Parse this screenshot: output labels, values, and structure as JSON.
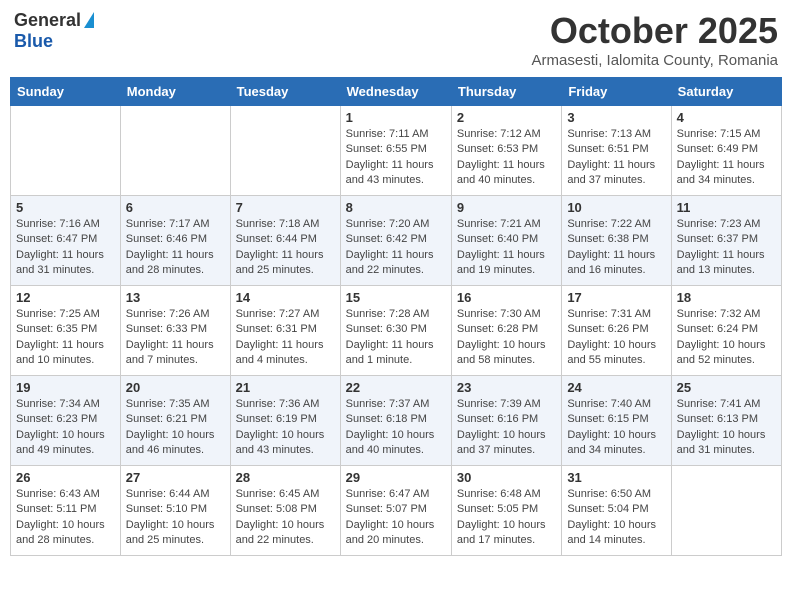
{
  "header": {
    "logo_general": "General",
    "logo_blue": "Blue",
    "month_title": "October 2025",
    "location": "Armasesti, Ialomita County, Romania"
  },
  "weekdays": [
    "Sunday",
    "Monday",
    "Tuesday",
    "Wednesday",
    "Thursday",
    "Friday",
    "Saturday"
  ],
  "weeks": [
    [
      {
        "day": "",
        "info": ""
      },
      {
        "day": "",
        "info": ""
      },
      {
        "day": "",
        "info": ""
      },
      {
        "day": "1",
        "info": "Sunrise: 7:11 AM\nSunset: 6:55 PM\nDaylight: 11 hours and 43 minutes."
      },
      {
        "day": "2",
        "info": "Sunrise: 7:12 AM\nSunset: 6:53 PM\nDaylight: 11 hours and 40 minutes."
      },
      {
        "day": "3",
        "info": "Sunrise: 7:13 AM\nSunset: 6:51 PM\nDaylight: 11 hours and 37 minutes."
      },
      {
        "day": "4",
        "info": "Sunrise: 7:15 AM\nSunset: 6:49 PM\nDaylight: 11 hours and 34 minutes."
      }
    ],
    [
      {
        "day": "5",
        "info": "Sunrise: 7:16 AM\nSunset: 6:47 PM\nDaylight: 11 hours and 31 minutes."
      },
      {
        "day": "6",
        "info": "Sunrise: 7:17 AM\nSunset: 6:46 PM\nDaylight: 11 hours and 28 minutes."
      },
      {
        "day": "7",
        "info": "Sunrise: 7:18 AM\nSunset: 6:44 PM\nDaylight: 11 hours and 25 minutes."
      },
      {
        "day": "8",
        "info": "Sunrise: 7:20 AM\nSunset: 6:42 PM\nDaylight: 11 hours and 22 minutes."
      },
      {
        "day": "9",
        "info": "Sunrise: 7:21 AM\nSunset: 6:40 PM\nDaylight: 11 hours and 19 minutes."
      },
      {
        "day": "10",
        "info": "Sunrise: 7:22 AM\nSunset: 6:38 PM\nDaylight: 11 hours and 16 minutes."
      },
      {
        "day": "11",
        "info": "Sunrise: 7:23 AM\nSunset: 6:37 PM\nDaylight: 11 hours and 13 minutes."
      }
    ],
    [
      {
        "day": "12",
        "info": "Sunrise: 7:25 AM\nSunset: 6:35 PM\nDaylight: 11 hours and 10 minutes."
      },
      {
        "day": "13",
        "info": "Sunrise: 7:26 AM\nSunset: 6:33 PM\nDaylight: 11 hours and 7 minutes."
      },
      {
        "day": "14",
        "info": "Sunrise: 7:27 AM\nSunset: 6:31 PM\nDaylight: 11 hours and 4 minutes."
      },
      {
        "day": "15",
        "info": "Sunrise: 7:28 AM\nSunset: 6:30 PM\nDaylight: 11 hours and 1 minute."
      },
      {
        "day": "16",
        "info": "Sunrise: 7:30 AM\nSunset: 6:28 PM\nDaylight: 10 hours and 58 minutes."
      },
      {
        "day": "17",
        "info": "Sunrise: 7:31 AM\nSunset: 6:26 PM\nDaylight: 10 hours and 55 minutes."
      },
      {
        "day": "18",
        "info": "Sunrise: 7:32 AM\nSunset: 6:24 PM\nDaylight: 10 hours and 52 minutes."
      }
    ],
    [
      {
        "day": "19",
        "info": "Sunrise: 7:34 AM\nSunset: 6:23 PM\nDaylight: 10 hours and 49 minutes."
      },
      {
        "day": "20",
        "info": "Sunrise: 7:35 AM\nSunset: 6:21 PM\nDaylight: 10 hours and 46 minutes."
      },
      {
        "day": "21",
        "info": "Sunrise: 7:36 AM\nSunset: 6:19 PM\nDaylight: 10 hours and 43 minutes."
      },
      {
        "day": "22",
        "info": "Sunrise: 7:37 AM\nSunset: 6:18 PM\nDaylight: 10 hours and 40 minutes."
      },
      {
        "day": "23",
        "info": "Sunrise: 7:39 AM\nSunset: 6:16 PM\nDaylight: 10 hours and 37 minutes."
      },
      {
        "day": "24",
        "info": "Sunrise: 7:40 AM\nSunset: 6:15 PM\nDaylight: 10 hours and 34 minutes."
      },
      {
        "day": "25",
        "info": "Sunrise: 7:41 AM\nSunset: 6:13 PM\nDaylight: 10 hours and 31 minutes."
      }
    ],
    [
      {
        "day": "26",
        "info": "Sunrise: 6:43 AM\nSunset: 5:11 PM\nDaylight: 10 hours and 28 minutes."
      },
      {
        "day": "27",
        "info": "Sunrise: 6:44 AM\nSunset: 5:10 PM\nDaylight: 10 hours and 25 minutes."
      },
      {
        "day": "28",
        "info": "Sunrise: 6:45 AM\nSunset: 5:08 PM\nDaylight: 10 hours and 22 minutes."
      },
      {
        "day": "29",
        "info": "Sunrise: 6:47 AM\nSunset: 5:07 PM\nDaylight: 10 hours and 20 minutes."
      },
      {
        "day": "30",
        "info": "Sunrise: 6:48 AM\nSunset: 5:05 PM\nDaylight: 10 hours and 17 minutes."
      },
      {
        "day": "31",
        "info": "Sunrise: 6:50 AM\nSunset: 5:04 PM\nDaylight: 10 hours and 14 minutes."
      },
      {
        "day": "",
        "info": ""
      }
    ]
  ]
}
